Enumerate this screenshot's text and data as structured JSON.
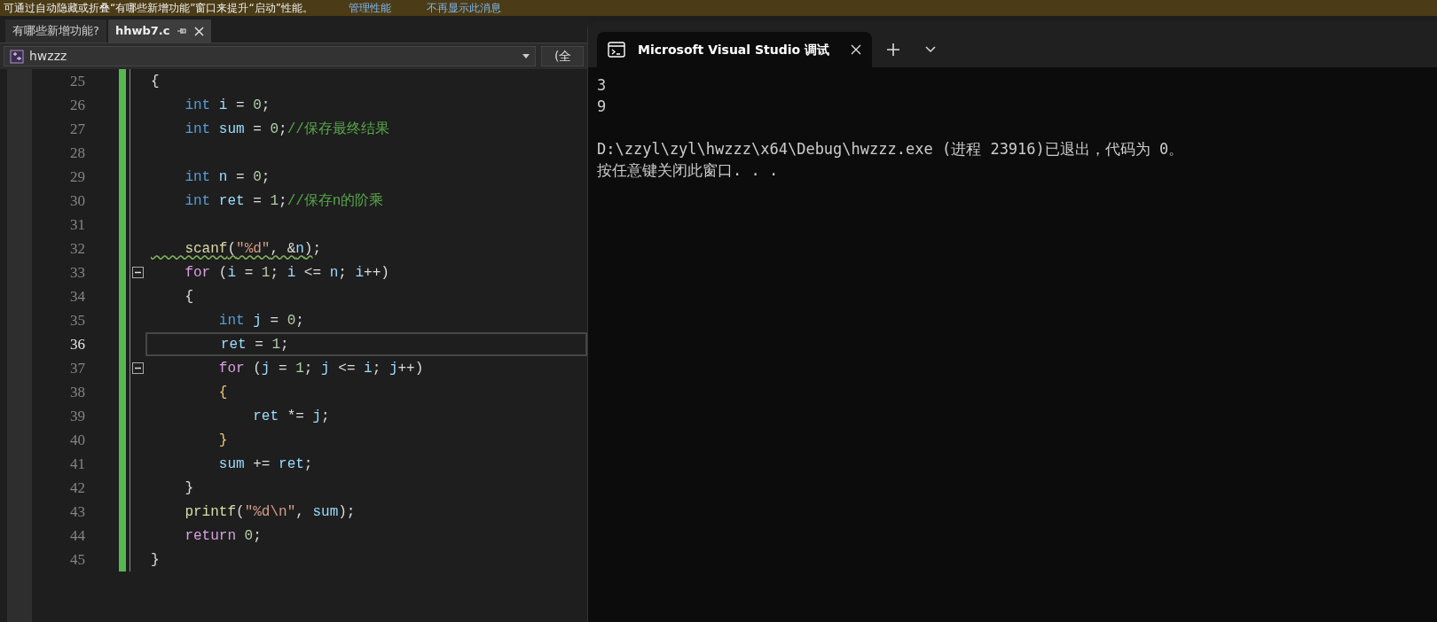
{
  "banner": {
    "message": "可通过自动隐藏或折叠“有哪些新增功能”窗口来提升“启动”性能。",
    "links": [
      "管理性能",
      "不再显示此消息"
    ]
  },
  "tabs": [
    {
      "label": "有哪些新增功能?",
      "selected": false,
      "pinned": false
    },
    {
      "label": "hhwb7.c",
      "selected": true,
      "pinned": true
    }
  ],
  "nav_bar": {
    "project": "hwzzz",
    "scope": "(全"
  },
  "code": {
    "lines": [
      {
        "number": "25",
        "current": false,
        "fold": false,
        "tokens": [
          {
            "kind": "punct",
            "text": "{"
          }
        ]
      },
      {
        "number": "26",
        "current": false,
        "fold": false,
        "tokens": [
          {
            "kind": "keyword",
            "text": "    int"
          },
          {
            "kind": "ident",
            "text": " i"
          },
          {
            "kind": "punct",
            "text": " = "
          },
          {
            "kind": "number",
            "text": "0"
          },
          {
            "kind": "punct",
            "text": ";"
          }
        ]
      },
      {
        "number": "27",
        "current": false,
        "fold": false,
        "tokens": [
          {
            "kind": "keyword",
            "text": "    int"
          },
          {
            "kind": "ident",
            "text": " sum"
          },
          {
            "kind": "punct",
            "text": " = "
          },
          {
            "kind": "number",
            "text": "0"
          },
          {
            "kind": "punct",
            "text": ";"
          },
          {
            "kind": "comment",
            "text": "//保存最终结果"
          }
        ]
      },
      {
        "number": "28",
        "current": false,
        "fold": false
      },
      {
        "number": "29",
        "current": false,
        "fold": false,
        "tokens": [
          {
            "kind": "keyword",
            "text": "    int"
          },
          {
            "kind": "ident",
            "text": " n"
          },
          {
            "kind": "punct",
            "text": " = "
          },
          {
            "kind": "number",
            "text": "0"
          },
          {
            "kind": "punct",
            "text": ";"
          }
        ]
      },
      {
        "number": "30",
        "current": false,
        "fold": false,
        "tokens": [
          {
            "kind": "keyword",
            "text": "    int"
          },
          {
            "kind": "ident",
            "text": " ret"
          },
          {
            "kind": "punct",
            "text": " = "
          },
          {
            "kind": "number",
            "text": "1"
          },
          {
            "kind": "punct",
            "text": ";"
          },
          {
            "kind": "comment",
            "text": "//保存n的阶乘"
          }
        ]
      },
      {
        "number": "31",
        "current": false,
        "fold": false
      },
      {
        "number": "32",
        "current": false,
        "fold": false,
        "tokens": [
          {
            "kind": "function",
            "text": "    scanf",
            "squiggle": true
          },
          {
            "kind": "punct",
            "text": "(",
            "squiggle": true
          },
          {
            "kind": "string",
            "text": "\"%d\"",
            "squiggle": true
          },
          {
            "kind": "punct",
            "text": ", &",
            "squiggle": true
          },
          {
            "kind": "ident",
            "text": "n",
            "squiggle": true
          },
          {
            "kind": "punct",
            "text": ")",
            "squiggle": true
          },
          {
            "kind": "punct",
            "text": ";"
          }
        ]
      },
      {
        "number": "33",
        "current": false,
        "fold": true,
        "tokens": [
          {
            "kind": "control",
            "text": "    for"
          },
          {
            "kind": "punct",
            "text": " ("
          },
          {
            "kind": "ident",
            "text": "i"
          },
          {
            "kind": "punct",
            "text": " = "
          },
          {
            "kind": "number",
            "text": "1"
          },
          {
            "kind": "punct",
            "text": "; "
          },
          {
            "kind": "ident",
            "text": "i"
          },
          {
            "kind": "punct",
            "text": " <= "
          },
          {
            "kind": "ident",
            "text": "n"
          },
          {
            "kind": "punct",
            "text": "; "
          },
          {
            "kind": "ident",
            "text": "i"
          },
          {
            "kind": "punct",
            "text": "++)"
          }
        ]
      },
      {
        "number": "34",
        "current": false,
        "fold": false,
        "tokens": [
          {
            "kind": "punct",
            "text": "    {"
          }
        ]
      },
      {
        "number": "35",
        "current": false,
        "fold": false,
        "tokens": [
          {
            "kind": "keyword",
            "text": "        int"
          },
          {
            "kind": "ident",
            "text": " j"
          },
          {
            "kind": "punct",
            "text": " = "
          },
          {
            "kind": "number",
            "text": "0"
          },
          {
            "kind": "punct",
            "text": ";"
          }
        ]
      },
      {
        "number": "36",
        "current": true,
        "fold": false,
        "tokens": [
          {
            "kind": "ident",
            "text": "        ret"
          },
          {
            "kind": "punct",
            "text": " = "
          },
          {
            "kind": "number",
            "text": "1"
          },
          {
            "kind": "punct",
            "text": ";"
          }
        ]
      },
      {
        "number": "37",
        "current": false,
        "fold": true,
        "tokens": [
          {
            "kind": "control",
            "text": "        for"
          },
          {
            "kind": "punct",
            "text": " ("
          },
          {
            "kind": "ident",
            "text": "j"
          },
          {
            "kind": "punct",
            "text": " = "
          },
          {
            "kind": "number",
            "text": "1"
          },
          {
            "kind": "punct",
            "text": "; "
          },
          {
            "kind": "ident",
            "text": "j"
          },
          {
            "kind": "punct",
            "text": " <= "
          },
          {
            "kind": "ident",
            "text": "i"
          },
          {
            "kind": "punct",
            "text": "; "
          },
          {
            "kind": "ident",
            "text": "j"
          },
          {
            "kind": "punct",
            "text": "++)"
          }
        ]
      },
      {
        "number": "38",
        "current": false,
        "fold": false,
        "tokens": [
          {
            "kind": "brace",
            "text": "        {"
          }
        ]
      },
      {
        "number": "39",
        "current": false,
        "fold": false,
        "tokens": [
          {
            "kind": "ident",
            "text": "            ret"
          },
          {
            "kind": "punct",
            "text": " *= "
          },
          {
            "kind": "ident",
            "text": "j"
          },
          {
            "kind": "punct",
            "text": ";"
          }
        ]
      },
      {
        "number": "40",
        "current": false,
        "fold": false,
        "tokens": [
          {
            "kind": "brace",
            "text": "        }"
          }
        ]
      },
      {
        "number": "41",
        "current": false,
        "fold": false,
        "tokens": [
          {
            "kind": "ident",
            "text": "        sum"
          },
          {
            "kind": "punct",
            "text": " += "
          },
          {
            "kind": "ident",
            "text": "ret"
          },
          {
            "kind": "punct",
            "text": ";"
          }
        ]
      },
      {
        "number": "42",
        "current": false,
        "fold": false,
        "tokens": [
          {
            "kind": "punct",
            "text": "    }"
          }
        ]
      },
      {
        "number": "43",
        "current": false,
        "fold": false,
        "tokens": [
          {
            "kind": "function",
            "text": "    printf"
          },
          {
            "kind": "punct",
            "text": "("
          },
          {
            "kind": "string",
            "text": "\"%d\\n\""
          },
          {
            "kind": "punct",
            "text": ", "
          },
          {
            "kind": "ident",
            "text": "sum"
          },
          {
            "kind": "punct",
            "text": ");"
          }
        ]
      },
      {
        "number": "44",
        "current": false,
        "fold": false,
        "tokens": [
          {
            "kind": "control",
            "text": "    return"
          },
          {
            "kind": "number",
            "text": " 0"
          },
          {
            "kind": "punct",
            "text": ";"
          }
        ]
      },
      {
        "number": "45",
        "current": false,
        "fold": false,
        "tokens": [
          {
            "kind": "punct",
            "text": "}"
          }
        ]
      }
    ]
  },
  "console": {
    "tab_title": "Microsoft Visual Studio 调试",
    "program_output": [
      "3",
      "9"
    ],
    "exit_message": [
      "D:\\zzyl\\zyl\\hwzzz\\x64\\Debug\\hwzzz.exe (进程 23916)已退出，代码为 0。",
      "按任意键关闭此窗口. . ."
    ]
  }
}
